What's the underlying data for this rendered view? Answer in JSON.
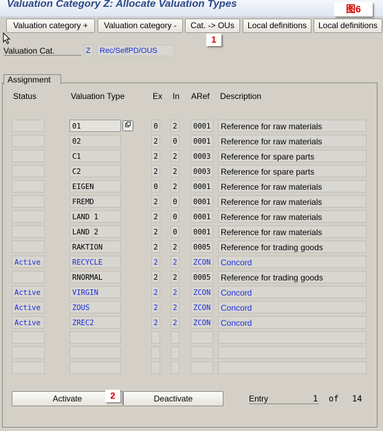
{
  "window": {
    "title": "Valuation Category Z: Allocate Valuation Types",
    "figure_label": "图6"
  },
  "toolbar": {
    "buttons": [
      "Valuation category +",
      "Valuation category -",
      "Cat. -> OUs",
      "Local definitions",
      "Local definitions"
    ]
  },
  "callouts": {
    "c1": "1",
    "c2": "2"
  },
  "header": {
    "valuation_cat_label": "Valuation Cat.",
    "valuation_cat_value": "Z",
    "valuation_cat_desc": "Rec/SelfPD/OUS"
  },
  "assignment": {
    "tab_label": "Assignment",
    "columns": {
      "status": "Status",
      "valuation_type": "Valuation Type",
      "ex": "Ex",
      "in": "In",
      "aref": "ARef",
      "description": "Description"
    },
    "rows": [
      {
        "status": "",
        "valuation_type": "01",
        "ex": "0",
        "in": "2",
        "aref": "0001",
        "description": "Reference for raw materials"
      },
      {
        "status": "",
        "valuation_type": "02",
        "ex": "2",
        "in": "0",
        "aref": "0001",
        "description": "Reference for raw materials"
      },
      {
        "status": "",
        "valuation_type": "C1",
        "ex": "2",
        "in": "2",
        "aref": "0003",
        "description": "Reference for spare parts"
      },
      {
        "status": "",
        "valuation_type": "C2",
        "ex": "2",
        "in": "2",
        "aref": "0003",
        "description": "Reference for spare parts"
      },
      {
        "status": "",
        "valuation_type": "EIGEN",
        "ex": "0",
        "in": "2",
        "aref": "0001",
        "description": "Reference for raw materials"
      },
      {
        "status": "",
        "valuation_type": "FREMD",
        "ex": "2",
        "in": "0",
        "aref": "0001",
        "description": "Reference for raw materials"
      },
      {
        "status": "",
        "valuation_type": "LAND 1",
        "ex": "2",
        "in": "0",
        "aref": "0001",
        "description": "Reference for raw materials"
      },
      {
        "status": "",
        "valuation_type": "LAND 2",
        "ex": "2",
        "in": "0",
        "aref": "0001",
        "description": "Reference for raw materials"
      },
      {
        "status": "",
        "valuation_type": "RAKTION",
        "ex": "2",
        "in": "2",
        "aref": "0005",
        "description": "Reference for trading goods"
      },
      {
        "status": "Active",
        "valuation_type": "RECYCLE",
        "ex": "2",
        "in": "2",
        "aref": "ZCON",
        "description": "Concord"
      },
      {
        "status": "",
        "valuation_type": "RNORMAL",
        "ex": "2",
        "in": "2",
        "aref": "0005",
        "description": "Reference for trading goods"
      },
      {
        "status": "Active",
        "valuation_type": "VIRGIN",
        "ex": "2",
        "in": "2",
        "aref": "ZCON",
        "description": "Concord"
      },
      {
        "status": "Active",
        "valuation_type": "ZOUS",
        "ex": "2",
        "in": "2",
        "aref": "ZCON",
        "description": "Concord"
      },
      {
        "status": "Active",
        "valuation_type": "ZREC2",
        "ex": "2",
        "in": "2",
        "aref": "ZCON",
        "description": "Concord"
      },
      {
        "status": "",
        "valuation_type": "",
        "ex": "",
        "in": "",
        "aref": "",
        "description": ""
      },
      {
        "status": "",
        "valuation_type": "",
        "ex": "",
        "in": "",
        "aref": "",
        "description": ""
      },
      {
        "status": "",
        "valuation_type": "",
        "ex": "",
        "in": "",
        "aref": "",
        "description": ""
      }
    ]
  },
  "footer": {
    "activate_label": "Activate",
    "deactivate_label": "Deactivate",
    "entry_label": "Entry",
    "entry_current": "1",
    "of_label": "of",
    "entry_total": "14"
  },
  "colors": {
    "active_text": "#1a2edb",
    "title_text": "#2d4a86",
    "callout_text": "#d40000"
  },
  "icons": {
    "f4_help": "possible-entries-icon",
    "cursor": "mouse-pointer-icon"
  }
}
